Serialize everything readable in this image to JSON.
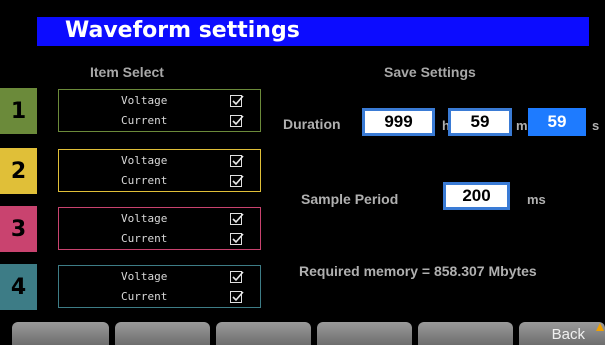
{
  "title": "Waveform settings",
  "item_select_heading": "Item Select",
  "save_settings_heading": "Save Settings",
  "channels": [
    {
      "number": "1",
      "color": "#6b8a3a",
      "rows": [
        {
          "label": "Voltage",
          "checked": true
        },
        {
          "label": "Current",
          "checked": true
        }
      ]
    },
    {
      "number": "2",
      "color": "#e0bf38",
      "rows": [
        {
          "label": "Voltage",
          "checked": true
        },
        {
          "label": "Current",
          "checked": true
        }
      ]
    },
    {
      "number": "3",
      "color": "#c9436f",
      "rows": [
        {
          "label": "Voltage",
          "checked": true
        },
        {
          "label": "Current",
          "checked": true
        }
      ]
    },
    {
      "number": "4",
      "color": "#3d7c86",
      "rows": [
        {
          "label": "Voltage",
          "checked": true
        },
        {
          "label": "Current",
          "checked": true
        }
      ]
    }
  ],
  "duration": {
    "label": "Duration",
    "hours": "999",
    "hours_unit": "h",
    "minutes": "59",
    "minutes_unit": "m",
    "seconds": "59",
    "seconds_unit": "s"
  },
  "sample_period": {
    "label": "Sample Period",
    "value": "200",
    "unit": "ms"
  },
  "required_memory": "Required memory = 858.307 Mbytes",
  "softkeys": [
    "",
    "",
    "",
    "",
    "",
    "Back"
  ],
  "colors": {
    "title_bg": "#0c0cff",
    "active_field": "#1e7bff",
    "field_border": "#3a7bd5"
  }
}
